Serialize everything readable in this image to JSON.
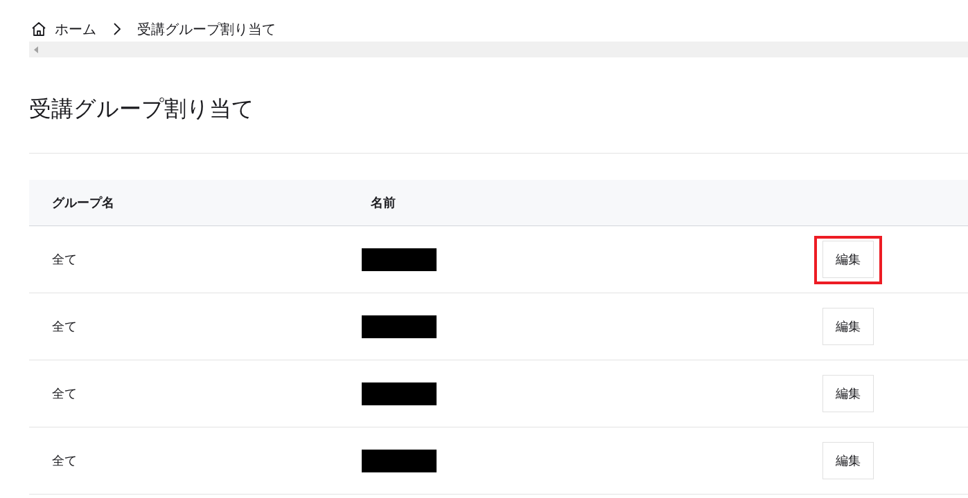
{
  "breadcrumb": [
    {
      "label": "ホーム",
      "kind": "home"
    },
    {
      "label": "受講グループ割り当て",
      "kind": "current"
    }
  ],
  "title": "受講グループ割り当て",
  "table": {
    "columns": [
      "グループ名",
      "名前"
    ],
    "rows": [
      {
        "group": "全て",
        "name_redacted": true,
        "action": "編集",
        "highlighted": true
      },
      {
        "group": "全て",
        "name_redacted": true,
        "action": "編集",
        "highlighted": false
      },
      {
        "group": "全て",
        "name_redacted": true,
        "action": "編集",
        "highlighted": false
      },
      {
        "group": "全て",
        "name_redacted": true,
        "action": "編集",
        "highlighted": false
      }
    ]
  }
}
